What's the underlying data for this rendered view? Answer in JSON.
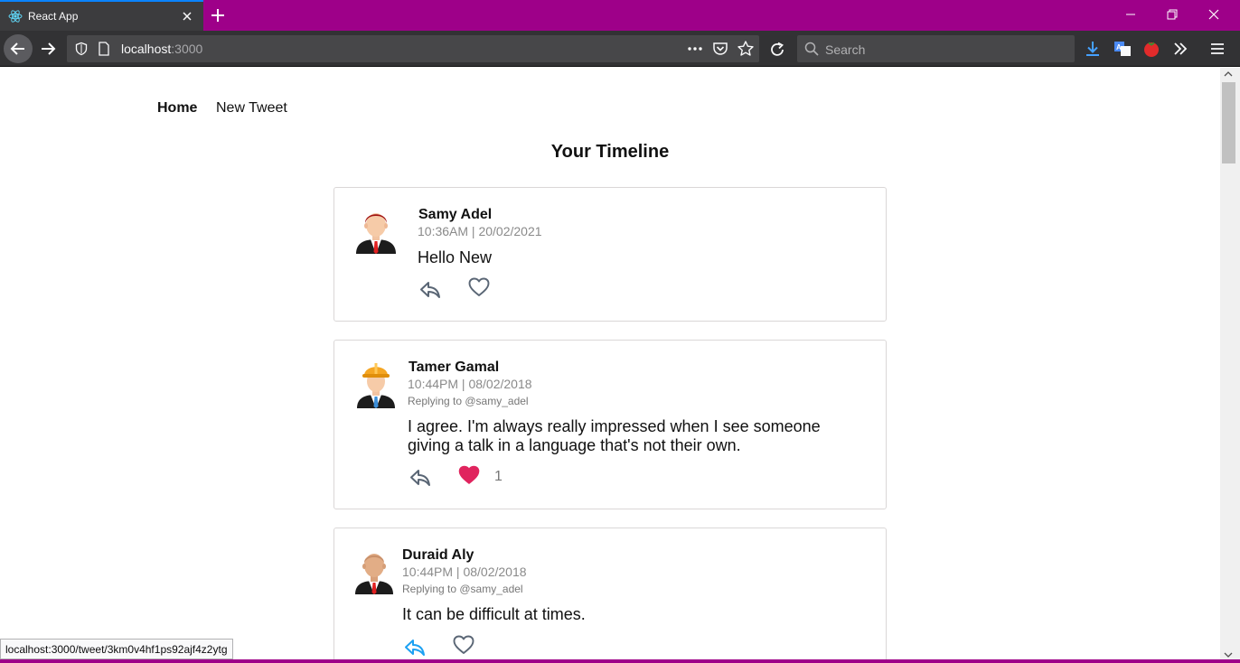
{
  "browser": {
    "tab_title": "React App",
    "url_host": "localhost",
    "url_port": ":3000",
    "search_placeholder": "Search",
    "status_url": "localhost:3000/tweet/3km0v4hf1ps92ajf4z2ytg",
    "accent_color": "#9e0089"
  },
  "nav": {
    "home": "Home",
    "new_tweet": "New Tweet"
  },
  "timeline": {
    "title": "Your Timeline",
    "tweets": [
      {
        "author": "Samy Adel",
        "time": "10:36AM | 20/02/2021",
        "replying_to": "",
        "text": "Hello New",
        "liked": false,
        "likes": "",
        "avatar": "businessman-red-hair-avatar"
      },
      {
        "author": "Tamer Gamal",
        "time": "10:44PM | 08/02/2018",
        "replying_to": "Replying to @samy_adel",
        "text": "I agree. I'm always really impressed when I see someone giving a talk in a language that's not their own.",
        "liked": true,
        "likes": "1",
        "avatar": "construction-worker-avatar"
      },
      {
        "author": "Duraid Aly",
        "time": "10:44PM | 08/02/2018",
        "replying_to": "Replying to @samy_adel",
        "text": "It can be difficult at times.",
        "liked": false,
        "likes": "",
        "avatar": "bald-businessman-avatar"
      }
    ]
  },
  "colors": {
    "like_active": "#e0245e",
    "reply_hover": "#1da1f2",
    "icon_gray": "#5a6675"
  }
}
